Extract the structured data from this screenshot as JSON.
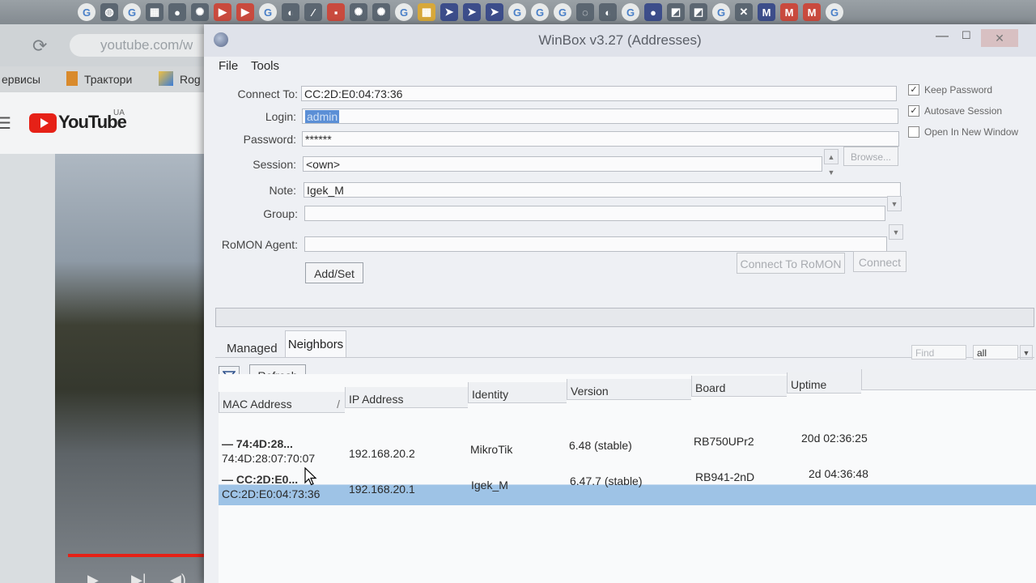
{
  "taskbar": {
    "favicons": [
      {
        "icon": "google-icon",
        "glyph": "G",
        "kind": "g"
      },
      {
        "icon": "world-icon",
        "glyph": "◍",
        "kind": "d"
      },
      {
        "icon": "google-icon",
        "glyph": "G",
        "kind": "g"
      },
      {
        "icon": "app-icon",
        "glyph": "▦",
        "kind": "d"
      },
      {
        "icon": "app-icon",
        "glyph": "●",
        "kind": "d"
      },
      {
        "icon": "settings-icon",
        "glyph": "✺",
        "kind": "d"
      },
      {
        "icon": "youtube-icon",
        "glyph": "▶",
        "kind": "r"
      },
      {
        "icon": "youtube-icon",
        "glyph": "▶",
        "kind": "r"
      },
      {
        "icon": "google-icon",
        "glyph": "G",
        "kind": "g"
      },
      {
        "icon": "app-icon",
        "glyph": "◐",
        "kind": "d"
      },
      {
        "icon": "edit-icon",
        "glyph": "∕",
        "kind": "d"
      },
      {
        "icon": "app-icon",
        "glyph": "▪",
        "kind": "r"
      },
      {
        "icon": "settings-icon",
        "glyph": "✺",
        "kind": "d"
      },
      {
        "icon": "settings-icon",
        "glyph": "✺",
        "kind": "d"
      },
      {
        "icon": "google-icon",
        "glyph": "G",
        "kind": "g"
      },
      {
        "icon": "app-icon",
        "glyph": "▦",
        "kind": "y"
      },
      {
        "icon": "app-icon",
        "glyph": "➤",
        "kind": "m"
      },
      {
        "icon": "app-icon",
        "glyph": "➤",
        "kind": "m"
      },
      {
        "icon": "app-icon",
        "glyph": "➤",
        "kind": "m"
      },
      {
        "icon": "google-icon",
        "glyph": "G",
        "kind": "g"
      },
      {
        "icon": "google-icon",
        "glyph": "G",
        "kind": "g"
      },
      {
        "icon": "google-icon",
        "glyph": "G",
        "kind": "g"
      },
      {
        "icon": "app-icon",
        "glyph": "◌",
        "kind": "d"
      },
      {
        "icon": "app-icon",
        "glyph": "◐",
        "kind": "d"
      },
      {
        "icon": "google-icon",
        "glyph": "G",
        "kind": "g"
      },
      {
        "icon": "app-icon",
        "glyph": "●",
        "kind": "m"
      },
      {
        "icon": "app-icon",
        "glyph": "◩",
        "kind": "d"
      },
      {
        "icon": "app-icon",
        "glyph": "◩",
        "kind": "d"
      },
      {
        "icon": "google-icon",
        "glyph": "G",
        "kind": "g"
      },
      {
        "icon": "app-icon",
        "glyph": "✕",
        "kind": "d"
      },
      {
        "icon": "m-icon",
        "glyph": "M",
        "kind": "m"
      },
      {
        "icon": "m-icon",
        "glyph": "M",
        "kind": "r"
      },
      {
        "icon": "m-icon",
        "glyph": "M",
        "kind": "r"
      },
      {
        "icon": "google-icon",
        "glyph": "G",
        "kind": "g"
      }
    ]
  },
  "browser": {
    "url": "youtube.com/w",
    "bookmarks": {
      "services": "ервисы",
      "tractors": "Трактори",
      "rog": "Rog"
    },
    "youtube": {
      "wordmark": "YouTube",
      "region": "UA"
    },
    "controls": {
      "play": "▶",
      "next": "▶|",
      "volume": "◀)"
    }
  },
  "winbox": {
    "title": "WinBox v3.27 (Addresses)",
    "menu": {
      "file": "File",
      "tools": "Tools"
    },
    "titlebar_buttons": {
      "minimize": "—",
      "maximize": "☐",
      "close": "✕"
    },
    "labels": {
      "connect_to": "Connect To:",
      "login": "Login:",
      "password": "Password:",
      "session": "Session:",
      "note": "Note:",
      "group": "Group:",
      "romon_agent": "RoMON Agent:"
    },
    "fields": {
      "connect_to": "CC:2D:E0:04:73:36",
      "login": "admin",
      "password": "******",
      "session": "<own>",
      "note": "Igek_M",
      "group": "",
      "romon_agent": ""
    },
    "checkboxes": [
      {
        "label": "Keep Password",
        "checked": true
      },
      {
        "label": "Autosave Session",
        "checked": true
      },
      {
        "label": "Open In New Window",
        "checked": false
      }
    ],
    "buttons": {
      "browse": "Browse...",
      "add_set": "Add/Set",
      "connect_romon": "Connect To RoMON",
      "connect": "Connect",
      "refresh": "Refresh"
    },
    "tabs": {
      "managed": "Managed",
      "neighbors": "Neighbors"
    },
    "filter": {
      "find_placeholder": "Find",
      "scope": "all"
    },
    "table": {
      "columns": [
        "MAC Address",
        "IP Address",
        "Identity",
        "Version",
        "Board",
        "Uptime"
      ],
      "sort_indicator": "/",
      "rows": [
        {
          "group": "— 74:4D:28...",
          "mac": "74:4D:28:07:70:07",
          "ip": "192.168.20.2",
          "identity": "MikroTik",
          "version": "6.48 (stable)",
          "board": "RB750UPr2",
          "uptime": "20d 02:36:25",
          "selected": false
        },
        {
          "group": "— CC:2D:E0...",
          "mac": "CC:2D:E0:04:73:36",
          "ip": "192.168.20.1",
          "identity": "Igek_M",
          "version": "6.47.7 (stable)",
          "board": "RB941-2nD",
          "uptime": "2d 04:36:48",
          "selected": true
        }
      ]
    }
  },
  "colors": {
    "selection": "#9ec3e6",
    "login_highlight": "#5b8fd6",
    "youtube_red": "#e62117"
  }
}
